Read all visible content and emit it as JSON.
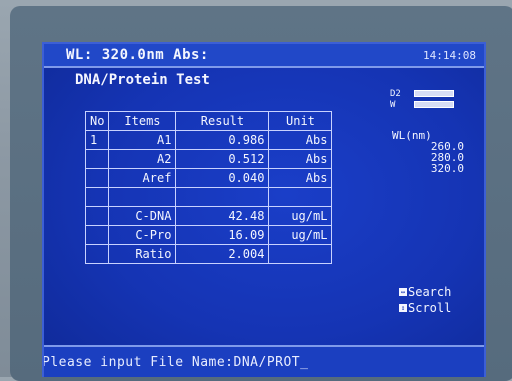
{
  "header": {
    "wavelength_label": "WL: 320.0nm Abs:",
    "time": "14:14:08"
  },
  "title": "DNA/Protein Test",
  "lamps": [
    {
      "label": "D2"
    },
    {
      "label": "W"
    }
  ],
  "table": {
    "headers": {
      "no": "No",
      "items": "Items",
      "result": "Result",
      "unit": "Unit"
    },
    "rows": [
      {
        "no": "1",
        "item": "A1",
        "result": "0.986",
        "unit": "Abs"
      },
      {
        "no": "",
        "item": "A2",
        "result": "0.512",
        "unit": "Abs"
      },
      {
        "no": "",
        "item": "Aref",
        "result": "0.040",
        "unit": "Abs"
      },
      {
        "no": "",
        "item": "",
        "result": "",
        "unit": ""
      },
      {
        "no": "",
        "item": "C-DNA",
        "result": "42.48",
        "unit": "ug/mL"
      },
      {
        "no": "",
        "item": "C-Pro",
        "result": "16.09",
        "unit": "ug/mL"
      },
      {
        "no": "",
        "item": "Ratio",
        "result": "2.004",
        "unit": ""
      }
    ]
  },
  "wl_panel": {
    "label": "WL(nm)",
    "values": [
      "260.0",
      "280.0",
      "320.0"
    ]
  },
  "hints": {
    "search": "Search",
    "scroll": "Scroll"
  },
  "status": {
    "message": "Please input File Name:DNA/PROT_"
  }
}
